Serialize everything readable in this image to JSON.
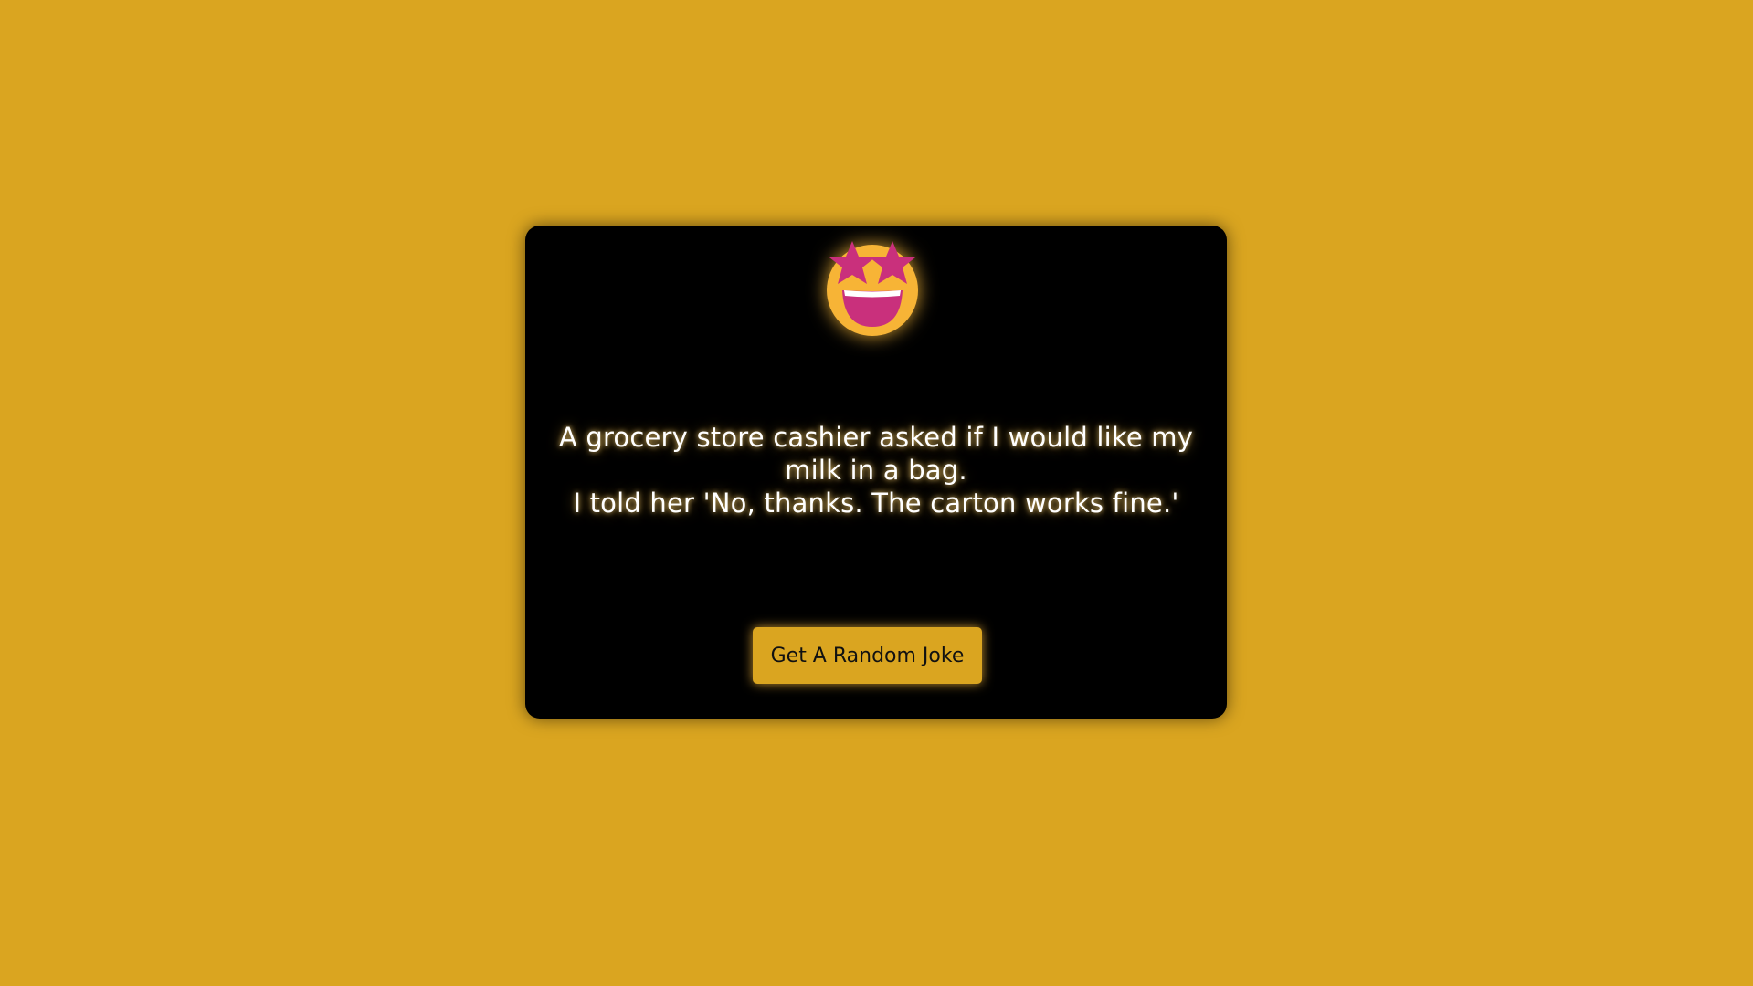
{
  "page": {
    "background_color": "#daa520"
  },
  "card": {
    "background_color": "#000000",
    "emoji_icon": "star-struck-face-icon",
    "joke_lines": [
      "A grocery store cashier asked if I would like my milk in a bag.",
      "I told her 'No, thanks. The carton works fine.'"
    ],
    "button_label": "Get A Random Joke",
    "accent_color": "#daa520"
  }
}
